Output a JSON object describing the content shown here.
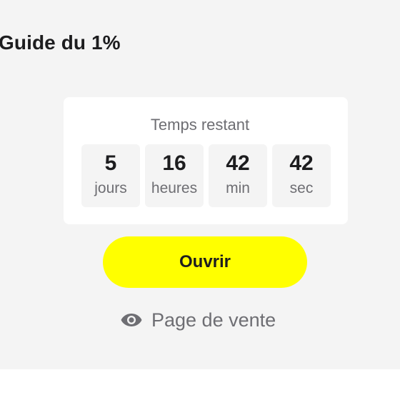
{
  "product": {
    "title": "Guide du 1%"
  },
  "countdown": {
    "label": "Temps restant",
    "units": [
      {
        "value": "5",
        "label": "jours"
      },
      {
        "value": "16",
        "label": "heures"
      },
      {
        "value": "42",
        "label": "min"
      },
      {
        "value": "42",
        "label": "sec"
      }
    ]
  },
  "actions": {
    "open_label": "Ouvrir",
    "sales_page_label": "Page de vente",
    "sales_page_icon": "eye-icon"
  },
  "colors": {
    "accent": "#ffff00",
    "panel_bg": "#f4f4f4",
    "muted_text": "#6e6e73"
  }
}
